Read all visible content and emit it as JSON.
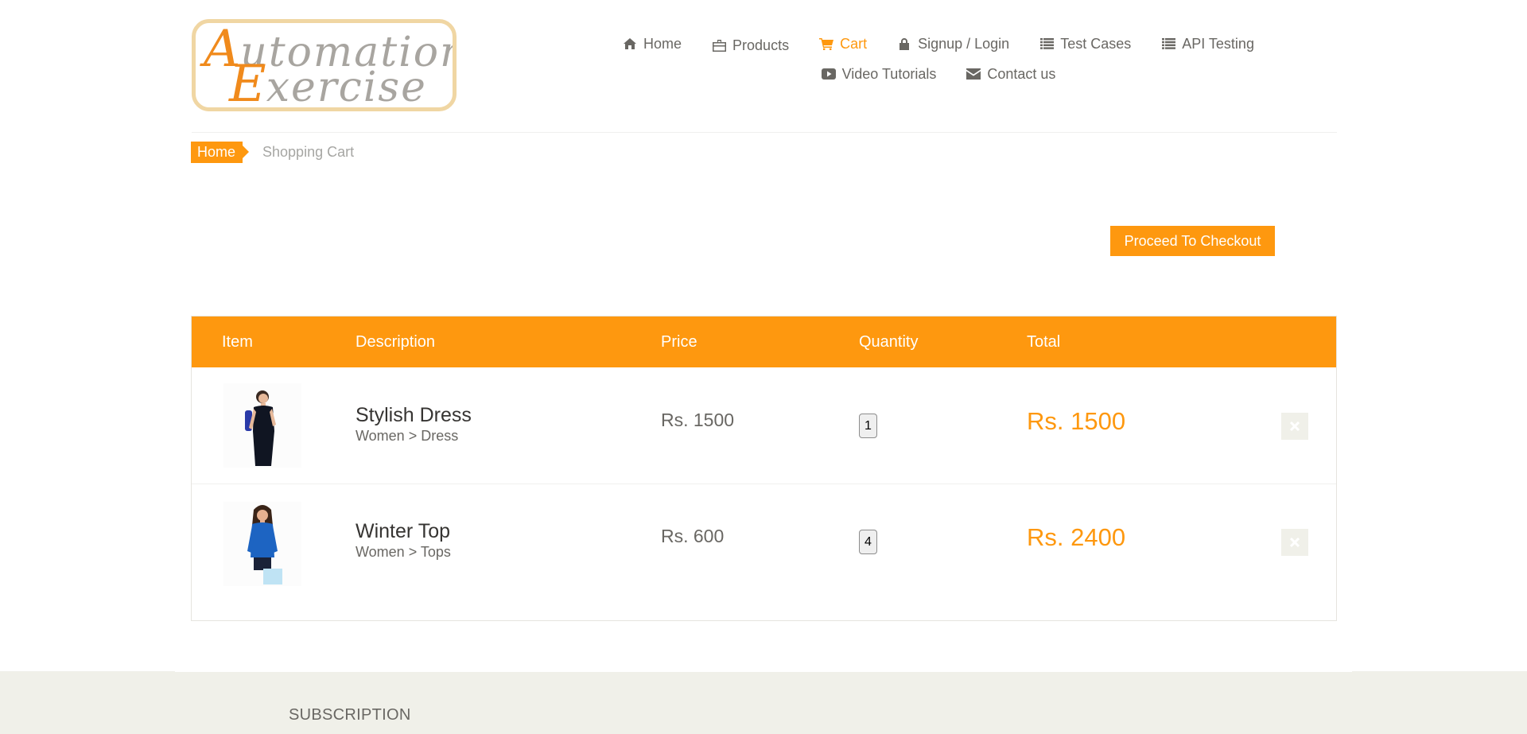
{
  "logo": {
    "line1_cap": "A",
    "line1_rest": "utomation",
    "line2_cap": "E",
    "line2_rest": "xercise"
  },
  "nav": {
    "row1": [
      {
        "label": "Home",
        "icon": "home-icon"
      },
      {
        "label": "Products",
        "icon": "products-icon"
      },
      {
        "label": "Cart",
        "icon": "cart-icon",
        "active": true
      },
      {
        "label": "Signup / Login",
        "icon": "lock-icon"
      },
      {
        "label": "Test Cases",
        "icon": "list-icon"
      },
      {
        "label": "API Testing",
        "icon": "list-icon"
      }
    ],
    "row2": [
      {
        "label": "Video Tutorials",
        "icon": "youtube-play-icon"
      },
      {
        "label": "Contact us",
        "icon": "envelope-icon"
      }
    ]
  },
  "breadcrumb": {
    "home": "Home",
    "current": "Shopping Cart"
  },
  "checkout": {
    "label": "Proceed To Checkout"
  },
  "cart": {
    "headers": {
      "item": "Item",
      "description": "Description",
      "price": "Price",
      "quantity": "Quantity",
      "total": "Total"
    },
    "rows": [
      {
        "name": "Stylish Dress",
        "category": "Women > Dress",
        "price": "Rs. 1500",
        "quantity": "1",
        "total": "Rs. 1500"
      },
      {
        "name": "Winter Top",
        "category": "Women > Tops",
        "price": "Rs. 600",
        "quantity": "4",
        "total": "Rs. 2400"
      }
    ]
  },
  "footer": {
    "subscription_title": "SUBSCRIPTION"
  },
  "colors": {
    "accent": "#fe980f",
    "text": "#696763",
    "footer_bg": "#f0f0e9"
  }
}
